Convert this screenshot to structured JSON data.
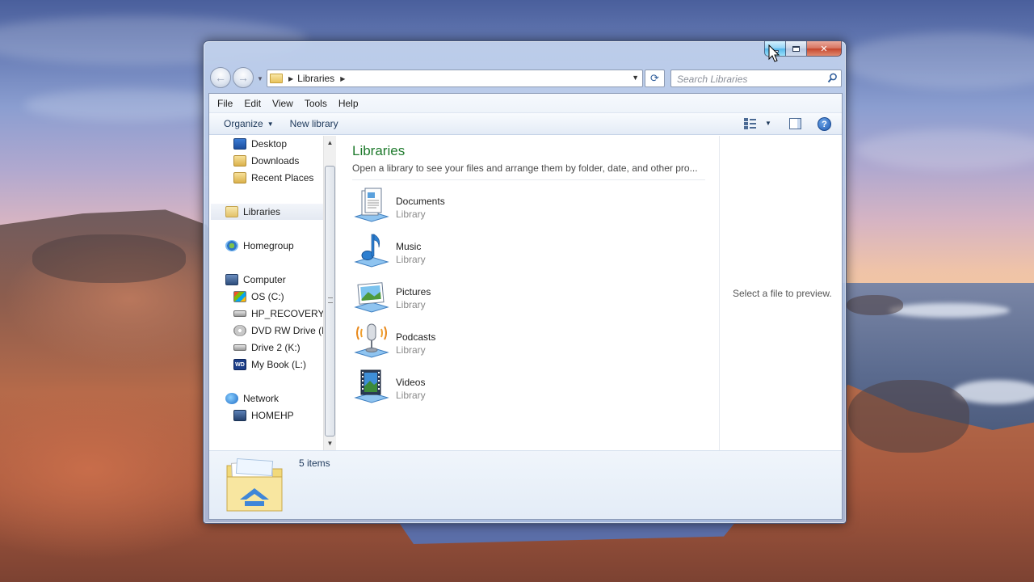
{
  "window": {
    "address": {
      "location": "Libraries"
    },
    "search": {
      "placeholder": "Search Libraries"
    },
    "menu": [
      "File",
      "Edit",
      "View",
      "Tools",
      "Help"
    ],
    "commands": {
      "organize": "Organize",
      "new_library": "New library"
    },
    "nav": {
      "favorites": [
        "Desktop",
        "Downloads",
        "Recent Places"
      ],
      "libraries": "Libraries",
      "homegroup": "Homegroup",
      "computer": "Computer",
      "drives": [
        "OS (C:)",
        "HP_RECOVERY (D",
        "DVD RW Drive (E:",
        "Drive 2 (K:)",
        "My Book (L:)"
      ],
      "network": "Network",
      "network_items": [
        "HOMEHP"
      ]
    },
    "content": {
      "title": "Libraries",
      "description": "Open a library to see your files and arrange them by folder, date, and other pro...",
      "items": [
        {
          "name": "Documents",
          "type": "Library",
          "icon": "documents-library-icon"
        },
        {
          "name": "Music",
          "type": "Library",
          "icon": "music-library-icon"
        },
        {
          "name": "Pictures",
          "type": "Library",
          "icon": "pictures-library-icon"
        },
        {
          "name": "Podcasts",
          "type": "Library",
          "icon": "podcasts-library-icon"
        },
        {
          "name": "Videos",
          "type": "Library",
          "icon": "videos-library-icon"
        }
      ]
    },
    "preview": {
      "text": "Select a file to preview."
    },
    "details": {
      "count": "5 items"
    }
  },
  "colors": {
    "title_green": "#1e7a2c",
    "command_blue": "#1e395b",
    "secondary_gray": "#8a8a8a"
  }
}
